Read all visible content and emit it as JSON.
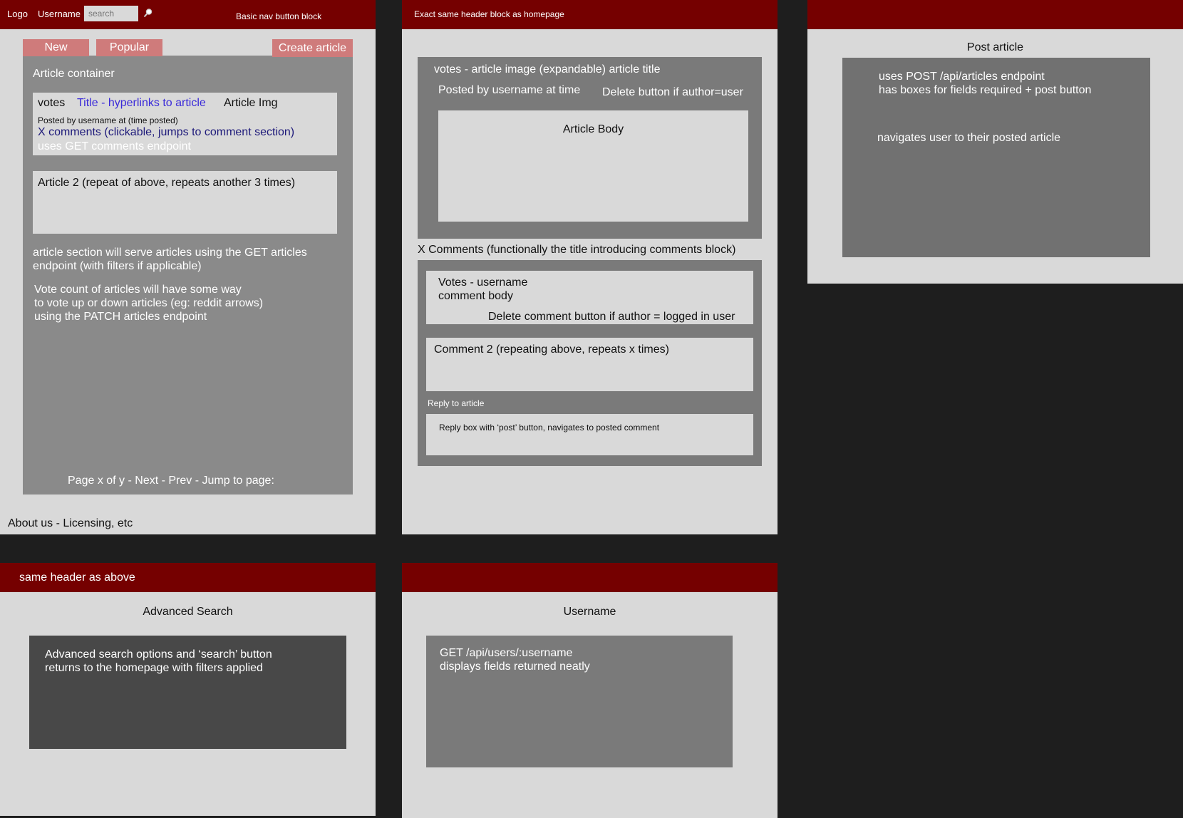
{
  "colors": {
    "header": "#750000",
    "button": "#cf7b7b",
    "link": "#3a2ad9",
    "comments_link": "#1e1a7a"
  },
  "home": {
    "nav": {
      "logo": "Logo",
      "username": "Username",
      "search_placeholder": "search",
      "search_icon": "magnifier-icon",
      "nav_block": "Basic nav button block"
    },
    "buttons": {
      "new": "New",
      "popular": "Popular",
      "create": "Create article"
    },
    "container_title": "Article container",
    "article1": {
      "votes": "votes",
      "title": "Title - hyperlinks to article",
      "img": "Article Img",
      "posted": "Posted by username at (time posted)",
      "comments": "X comments (clickable, jumps to comment section)",
      "endpoint": "uses GET comments endpoint"
    },
    "article2": "Article 2 (repeat of above, repeats another 3 times)",
    "note1_l1": "article section will serve articles using the GET articles",
    "note1_l2": "endpoint (with filters if applicable)",
    "note2_l1": "Vote count of articles will have some way",
    "note2_l2": "to vote up or down articles (eg: reddit arrows)",
    "note2_l3": "using the PATCH articles endpoint",
    "pagination": "Page x of y - Next - Prev - Jump to page:",
    "footer": "About us - Licensing, etc"
  },
  "article_page": {
    "header": "Exact same header block as homepage",
    "title_line": "votes - article image (expandable) article title",
    "posted": "Posted by username at time",
    "delete": "Delete button if author=user",
    "body": "Article Body",
    "comments_title": "X Comments (functionally the title introducing comments block)",
    "comment1_l1": "Votes - username",
    "comment1_l2": "comment body",
    "comment1_delete": "Delete comment button if author = logged in user",
    "comment2": "Comment 2 (repeating above, repeats x times)",
    "reply_label": "Reply to article",
    "reply_box": "Reply box with ‘post’ button, navigates to posted comment"
  },
  "post_page": {
    "title": "Post article",
    "l1": "uses POST /api/articles endpoint",
    "l2": "has boxes for fields required + post button",
    "l3": "navigates user to their posted article"
  },
  "search_page": {
    "header": "same header as above",
    "title": "Advanced Search",
    "l1": "Advanced search options and ‘search’ button",
    "l2": "returns to the homepage with filters applied"
  },
  "user_page": {
    "title": "Username",
    "l1": "GET /api/users/:username",
    "l2": "displays fields returned neatly"
  }
}
